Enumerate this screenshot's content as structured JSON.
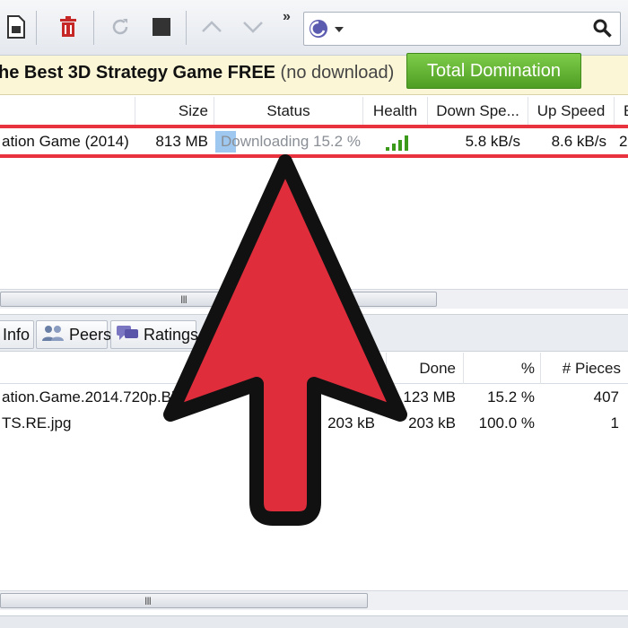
{
  "toolbar": {
    "more_glyph": "»",
    "search": {
      "value": "",
      "placeholder": ""
    },
    "icons": [
      "file-icon",
      "delete-icon",
      "refresh-icon",
      "stop-icon",
      "up-icon",
      "down-icon",
      "search-engine-icon",
      "search-icon"
    ]
  },
  "ad": {
    "text_bold": "he Best 3D Strategy Game FREE",
    "text_light": " (no download)",
    "button_label": "Total Domination"
  },
  "torrent_list": {
    "columns": [
      "Size",
      "Status",
      "Health",
      "Down Spe...",
      "Up Speed",
      "E"
    ],
    "row": {
      "name": "ation Game (2014)",
      "size": "813 MB",
      "status": "Downloading 15.2 %",
      "progress": 0.152,
      "down_speed": "5.8 kB/s",
      "up_speed": "8.6 kB/s",
      "eta": "2"
    }
  },
  "tabs": [
    {
      "label": "Info"
    },
    {
      "label": "Peers"
    },
    {
      "label": "Ratings"
    }
  ],
  "files": {
    "columns": [
      "Done",
      "%",
      "# Pieces"
    ],
    "rows": [
      {
        "name": "ation.Game.2014.720p.Blu",
        "size": "",
        "done": "123 MB",
        "percent": "15.2 %",
        "pieces": "407"
      },
      {
        "name": "TS.RE.jpg",
        "size": "203 kB",
        "done": "203 kB",
        "percent": "100.0 %",
        "pieces": "1"
      }
    ]
  },
  "scrollbar_grip": "III",
  "colors": {
    "highlight_red": "#e8333f",
    "arrow_fill": "#e02d3c",
    "ad_button": "#5fae2e",
    "health_green": "#3c9a1a"
  }
}
